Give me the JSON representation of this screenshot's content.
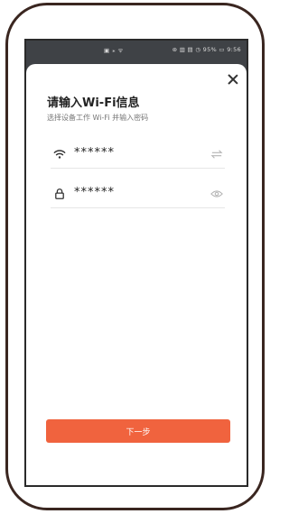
{
  "statusbar": {
    "left_icons": "▣ ⁎ ᯤ",
    "right_text": "⊛ ▥ ▤ ◷ 95% ▭ 9:56"
  },
  "underlay": {
    "dots": "·· ·"
  },
  "dialog": {
    "title": "请输入Wi-Fi信息",
    "subtitle": "选择设备工作 Wi-Fi 并输入密码",
    "wifi": {
      "value": "******",
      "icon": "wifi-icon",
      "action_icon": "swap-icon"
    },
    "password": {
      "value": "******",
      "icon": "lock-icon",
      "action_icon": "eye-icon"
    },
    "next_label": "下一步"
  },
  "colors": {
    "accent": "#f0633e",
    "frame": "#3a2620",
    "screen_bg": "#3f4246"
  }
}
